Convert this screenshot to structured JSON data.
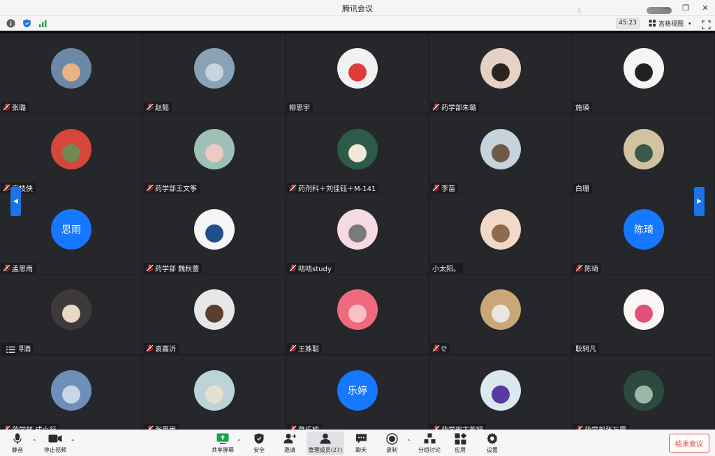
{
  "window": {
    "title": "腾讯会议"
  },
  "infobar": {
    "timer": "45:23",
    "view_label": "宫格视图"
  },
  "speaking": {
    "label": "正在讲话: 李友佳;"
  },
  "participants": [
    {
      "name": "张璐",
      "muted": true,
      "avatar": "photo",
      "colors": [
        "#6b88a6",
        "#e8b283"
      ]
    },
    {
      "name": "赵懿",
      "muted": true,
      "avatar": "photo",
      "colors": [
        "#8aa2b8",
        "#c8d3dc"
      ]
    },
    {
      "name": "柳思宇",
      "muted": false,
      "avatar": "photo",
      "colors": [
        "#f1f1f1",
        "#e23a3a"
      ]
    },
    {
      "name": "药学部朱璐",
      "muted": true,
      "avatar": "photo",
      "colors": [
        "#e6d1c6",
        "#2c2420"
      ]
    },
    {
      "name": "施瑛",
      "muted": false,
      "avatar": "photo",
      "colors": [
        "#f5f5f5",
        "#222222"
      ]
    },
    {
      "name": "席枝侠",
      "muted": true,
      "avatar": "photo",
      "colors": [
        "#d6463b",
        "#6f8b51"
      ]
    },
    {
      "name": "药学部王文筝",
      "muted": true,
      "avatar": "photo",
      "colors": [
        "#9ec0b7",
        "#f0c9c1"
      ]
    },
    {
      "name": "药剂科＋刘佳钰＋M-141",
      "muted": true,
      "avatar": "photo",
      "colors": [
        "#2d5b4a",
        "#f3e7d5"
      ]
    },
    {
      "name": "李苗",
      "muted": true,
      "avatar": "photo",
      "colors": [
        "#c6d3dc",
        "#6f5a47"
      ]
    },
    {
      "name": "白珊",
      "muted": false,
      "avatar": "photo",
      "colors": [
        "#d3c2a1",
        "#3b5a4a"
      ]
    },
    {
      "name": "孟思雨",
      "muted": true,
      "avatar": "text",
      "avatar_text": "思雨"
    },
    {
      "name": "药学部 魏秋蕾",
      "muted": true,
      "avatar": "photo",
      "colors": [
        "#f5f5f5",
        "#1f4e8b"
      ]
    },
    {
      "name": "咕咕study",
      "muted": true,
      "avatar": "photo",
      "colors": [
        "#f6d9e2",
        "#7a7a7a"
      ]
    },
    {
      "name": "小太阳。",
      "muted": false,
      "avatar": "photo",
      "colors": [
        "#f1d8c7",
        "#8f6a4e"
      ]
    },
    {
      "name": "陈琦",
      "muted": true,
      "avatar": "text",
      "avatar_text": "陈琦"
    },
    {
      "name": "山山得酒",
      "muted": false,
      "avatar": "photo",
      "colors": [
        "#3f3a3a",
        "#e8d7c4"
      ]
    },
    {
      "name": "袁嘉沂",
      "muted": true,
      "avatar": "photo",
      "colors": [
        "#e7e7e7",
        "#5b3f2e"
      ]
    },
    {
      "name": "王姝聪",
      "muted": true,
      "avatar": "photo",
      "colors": [
        "#f06a7e",
        "#f9c0c7"
      ]
    },
    {
      "name": "ღ",
      "muted": true,
      "avatar": "photo",
      "colors": [
        "#c9a777",
        "#e9e6e1"
      ]
    },
    {
      "name": "耿轲凡",
      "muted": false,
      "avatar": "photo",
      "colors": [
        "#fbf5f5",
        "#e24f7a"
      ]
    },
    {
      "name": "药学部-成小行",
      "muted": true,
      "avatar": "photo",
      "colors": [
        "#6e8fba",
        "#c8d6e8"
      ]
    },
    {
      "name": "张思雨",
      "muted": true,
      "avatar": "photo",
      "colors": [
        "#bcd3d8",
        "#e5e1d0"
      ]
    },
    {
      "name": "葛乐婷",
      "muted": true,
      "avatar": "text",
      "avatar_text": "乐婷"
    },
    {
      "name": "药学部卞若妍",
      "muted": true,
      "avatar": "photo",
      "colors": [
        "#dbe8f0",
        "#5a3aa0"
      ]
    },
    {
      "name": "药学部张万里",
      "muted": true,
      "avatar": "photo",
      "colors": [
        "#2d4a3e",
        "#9fb6aa"
      ]
    }
  ],
  "toolbar": {
    "mute": "静音",
    "stop_video": "停止视频",
    "share": "共享屏幕",
    "security": "安全",
    "invite": "邀请",
    "members": "管理成员(27)",
    "chat": "聊天",
    "record": "录制",
    "breakout": "分组讨论",
    "apps": "应用",
    "settings": "设置",
    "end": "结束会议"
  }
}
